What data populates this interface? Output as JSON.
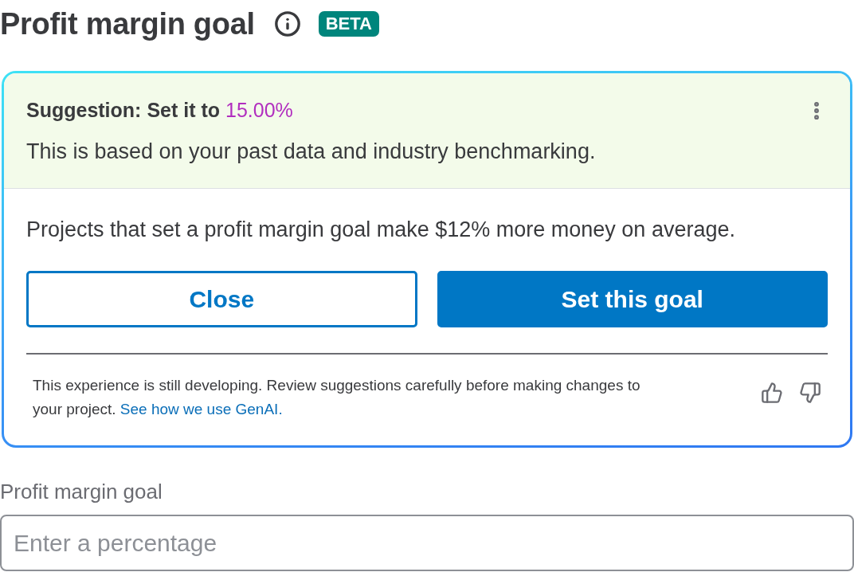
{
  "header": {
    "title": "Profit margin goal",
    "badge": "BETA"
  },
  "suggestion_card": {
    "label": "Suggestion: Set it to",
    "value": "15.00%",
    "explanation": "This is based on your past data and industry benchmarking.",
    "insight": "Projects that set a profit margin goal make $12% more money on average.",
    "buttons": [
      {
        "label": "Close",
        "kind": "secondary"
      },
      {
        "label": "Set this goal",
        "kind": "primary"
      }
    ],
    "disclaimer": "This experience is still developing. Review suggestions carefully before making changes to your project.",
    "link": "See how we use GenAI."
  },
  "field": {
    "label": "Profit margin goal",
    "placeholder": "Enter a percentage"
  }
}
